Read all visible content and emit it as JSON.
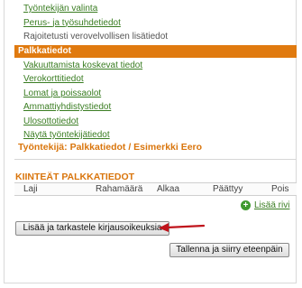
{
  "nav": {
    "items": [
      {
        "label": "Työntekijän valinta",
        "type": "link"
      },
      {
        "label": "Perus- ja työsuhdetiedot",
        "type": "link"
      },
      {
        "label": "Rajoitetusti verovelvollisen lisätiedot",
        "type": "static"
      },
      {
        "label": "Palkkatiedot",
        "type": "active"
      },
      {
        "label": "Vakuuttamista koskevat tiedot",
        "type": "link"
      },
      {
        "label": "Verokorttitiedot",
        "type": "link"
      },
      {
        "label": "Lomat ja poissaolot",
        "type": "link"
      },
      {
        "label": "Ammattiyhdistystiedot",
        "type": "link"
      },
      {
        "label": "Ulosottotiedot",
        "type": "link"
      },
      {
        "label": "Näytä työntekijätiedot",
        "type": "link"
      }
    ]
  },
  "page": {
    "title": "Työntekijä: Palkkatiedot / Esimerkki Eero"
  },
  "fixed_pay": {
    "title": "KIINTEÄT PALKKATIEDOT",
    "columns": [
      "Laji",
      "Rahamäärä",
      "Alkaa",
      "Päättyy",
      "Pois"
    ],
    "add_row_label": "Lisää rivi"
  },
  "buttons": {
    "add_and_review": "Lisää ja tarkastele kirjausoikeuksia",
    "save_and_continue": "Tallenna ja siirry eteenpäin"
  },
  "colors": {
    "accent": "#e07a0f",
    "link": "#3a7d22",
    "arrow": "#c0141c"
  }
}
